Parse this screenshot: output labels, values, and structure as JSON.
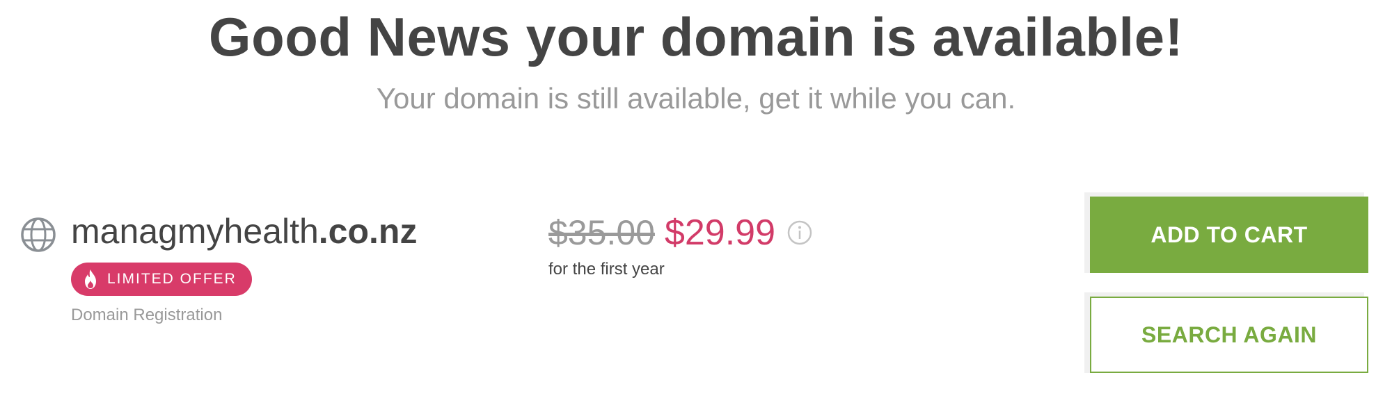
{
  "header": {
    "title": "Good News your domain is available!",
    "subtitle": "Your domain is still available, get it while you can."
  },
  "domain": {
    "icon": "globe-icon",
    "name": "managmyhealth",
    "tld": ".co.nz",
    "badge": {
      "icon": "flame-icon",
      "label": "LIMITED OFFER",
      "color": "#d83b69"
    },
    "type_label": "Domain Registration"
  },
  "pricing": {
    "old_price": "$35.00",
    "new_price": "$29.99",
    "info_icon": "info-icon",
    "note": "for the first year",
    "accent_color": "#d23b68"
  },
  "actions": {
    "add_to_cart_label": "ADD TO CART",
    "search_again_label": "SEARCH AGAIN",
    "brand_color": "#79ab40"
  }
}
